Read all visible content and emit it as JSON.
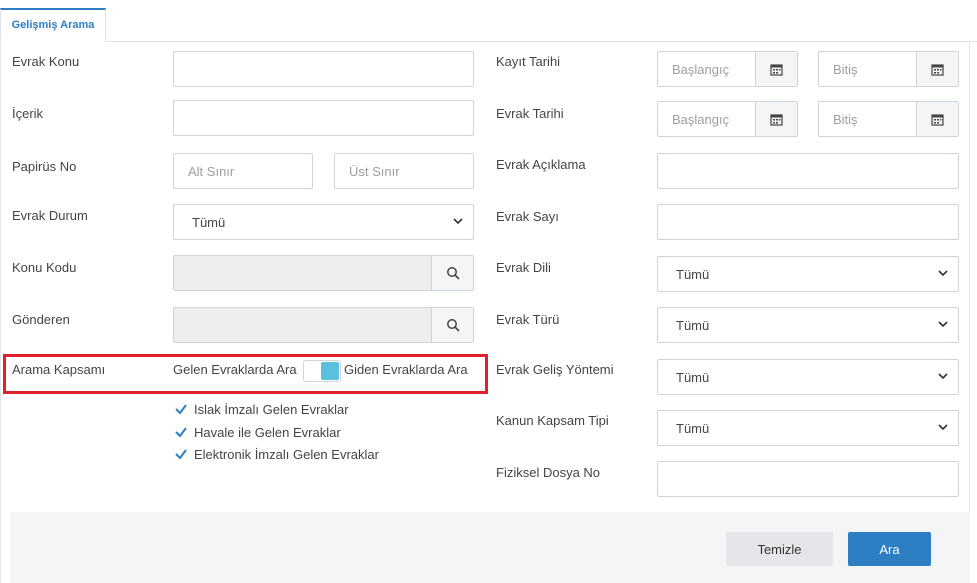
{
  "tab": {
    "label": "Gelişmiş Arama"
  },
  "left": {
    "konu": {
      "label": "Evrak Konu",
      "value": ""
    },
    "icerik": {
      "label": "İçerik",
      "value": ""
    },
    "papirus": {
      "label": "Papirüs No",
      "min_placeholder": "Alt Sınır",
      "max_placeholder": "Üst Sınır"
    },
    "durum": {
      "label": "Evrak Durum",
      "value": "Tümü"
    },
    "konu_kodu": {
      "label": "Konu Kodu",
      "value": ""
    },
    "gonderen": {
      "label": "Gönderen",
      "value": ""
    },
    "kapsam": {
      "label": "Arama Kapsamı",
      "left_option": "Gelen Evraklarda Ara",
      "right_option": "Giden Evraklarda Ara",
      "checkboxes": [
        {
          "label": "Islak İmzalı Gelen Evraklar",
          "checked": true
        },
        {
          "label": "Havale ile Gelen Evraklar",
          "checked": true
        },
        {
          "label": "Elektronik İmzalı Gelen Evraklar",
          "checked": true
        }
      ]
    }
  },
  "right": {
    "kayit_tarihi": {
      "label": "Kayıt Tarihi",
      "start_placeholder": "Başlangıç",
      "end_placeholder": "Bitiş"
    },
    "evrak_tarihi": {
      "label": "Evrak Tarihi",
      "start_placeholder": "Başlangıç",
      "end_placeholder": "Bitiş"
    },
    "aciklama": {
      "label": "Evrak Açıklama",
      "value": ""
    },
    "sayi": {
      "label": "Evrak Sayı",
      "value": ""
    },
    "dil": {
      "label": "Evrak Dili",
      "value": "Tümü"
    },
    "tur": {
      "label": "Evrak Türü",
      "value": "Tümü"
    },
    "gelis_yontemi": {
      "label": "Evrak Geliş Yöntemi",
      "value": "Tümü"
    },
    "kanun": {
      "label": "Kanun Kapsam Tipi",
      "value": "Tümü"
    },
    "dosya_no": {
      "label": "Fiziksel Dosya No",
      "value": ""
    }
  },
  "footer": {
    "clear_label": "Temizle",
    "search_label": "Ara"
  },
  "colors": {
    "accent": "#2d7ec2",
    "highlight": "#e0212b",
    "toggle": "#5bc0de"
  }
}
